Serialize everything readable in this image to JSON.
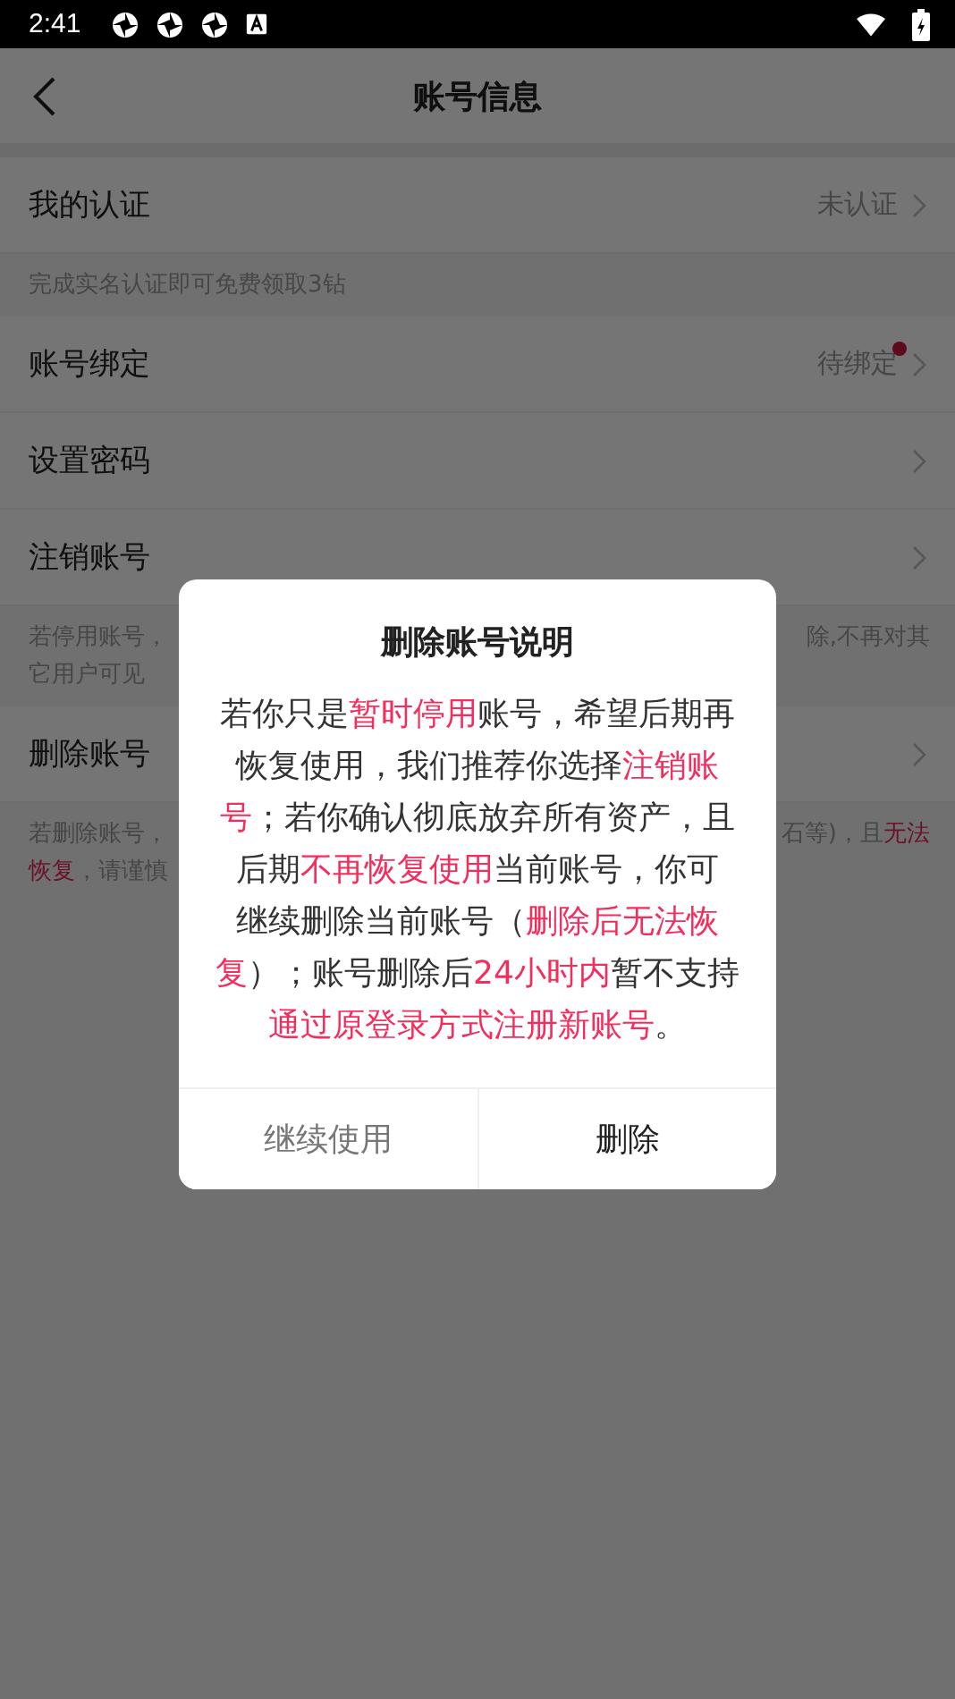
{
  "status_bar": {
    "time": "2:41"
  },
  "header": {
    "title": "账号信息"
  },
  "sections": [
    {
      "kind": "row",
      "label": "我的认证",
      "value": "未认证",
      "dot": false
    },
    {
      "kind": "note",
      "lines": [
        {
          "left": [
            {
              "text": "完成实名认证即可免费领取3钻",
              "highlight": false
            }
          ]
        }
      ]
    },
    {
      "kind": "row",
      "label": "账号绑定",
      "value": "待绑定",
      "dot": true
    },
    {
      "kind": "row",
      "label": "设置密码",
      "dot": false
    },
    {
      "kind": "row",
      "label": "注销账号",
      "dot": false
    },
    {
      "kind": "note",
      "lines": [
        {
          "left": [
            {
              "text": "若停用账号，",
              "highlight": false
            }
          ],
          "right": [
            {
              "text": "除,不再对其",
              "highlight": false
            }
          ]
        },
        {
          "left": [
            {
              "text": "它用户可见",
              "highlight": false
            }
          ]
        }
      ]
    },
    {
      "kind": "row",
      "label": "删除账号",
      "dot": false
    },
    {
      "kind": "note",
      "lines": [
        {
          "left": [
            {
              "text": "若删除账号，",
              "highlight": false
            }
          ],
          "right": [
            {
              "text": "石等)，且",
              "highlight": false
            },
            {
              "text": "无法",
              "highlight": true
            }
          ]
        },
        {
          "left": [
            {
              "text": "恢复",
              "highlight": true
            },
            {
              "text": "，请谨慎",
              "highlight": false
            }
          ]
        }
      ]
    }
  ],
  "dialog": {
    "title": "删除账号说明",
    "lines": [
      [
        {
          "text": "若你只是",
          "highlight": false
        },
        {
          "text": "暂时停用",
          "highlight": true
        },
        {
          "text": "账号，希望后期再",
          "highlight": false
        }
      ],
      [
        {
          "text": "恢复使用，我们推荐你选择",
          "highlight": false
        },
        {
          "text": "注销账",
          "highlight": true
        }
      ],
      [
        {
          "text": "号",
          "highlight": true
        },
        {
          "text": "；若你确认彻底放弃所有资产，且",
          "highlight": false
        }
      ],
      [
        {
          "text": "后期",
          "highlight": false
        },
        {
          "text": "不再恢复使用",
          "highlight": true
        },
        {
          "text": "当前账号，你可",
          "highlight": false
        }
      ],
      [
        {
          "text": "继续删除当前账号（",
          "highlight": false
        },
        {
          "text": "删除后无法恢",
          "highlight": true
        }
      ],
      [
        {
          "text": "复",
          "highlight": true
        },
        {
          "text": "）；账号删除后",
          "highlight": false
        },
        {
          "text": "24小时内",
          "highlight": true
        },
        {
          "text": "暂不支持",
          "highlight": false
        }
      ],
      [
        {
          "text": "通过原登录方式注册新账号",
          "highlight": true
        },
        {
          "text": "。",
          "highlight": false
        }
      ]
    ],
    "buttons": [
      {
        "label": "继续使用",
        "kind": "secondary"
      },
      {
        "label": "删除",
        "kind": "primary"
      }
    ]
  }
}
